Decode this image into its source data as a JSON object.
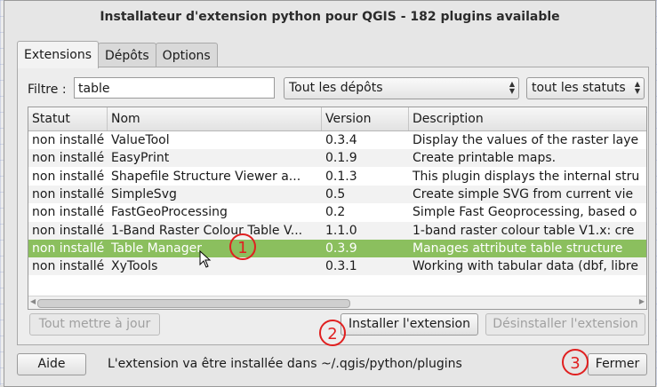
{
  "window": {
    "title": "Installateur d'extension python pour QGIS - 182 plugins available"
  },
  "tabs": [
    {
      "label": "Extensions",
      "active": true
    },
    {
      "label": "Dépôts",
      "active": false
    },
    {
      "label": "Options",
      "active": false
    }
  ],
  "filter": {
    "label": "Filtre :",
    "value": "table",
    "repository_select": "Tout les dépôts",
    "status_select": "tout les statuts"
  },
  "table": {
    "columns": [
      "Statut",
      "Nom",
      "Version",
      "Description"
    ],
    "rows": [
      {
        "status": "non installé",
        "name": "ValueTool",
        "version": "0.3.4",
        "description": "Display the values of the raster laye"
      },
      {
        "status": "non installé",
        "name": "EasyPrint",
        "version": "0.1.9",
        "description": "Create printable maps."
      },
      {
        "status": "non installé",
        "name": "Shapefile Structure Viewer a...",
        "version": "0.1.3",
        "description": "This plugin displays the internal stru"
      },
      {
        "status": "non installé",
        "name": "SimpleSvg",
        "version": "0.5",
        "description": "Create simple SVG from current vie"
      },
      {
        "status": "non installé",
        "name": "FastGeoProcessing",
        "version": "0.2",
        "description": "Simple Fast Geoprocessing, based o"
      },
      {
        "status": "non installé",
        "name": "1-Band Raster Colour Table V...",
        "version": "1.1.0",
        "description": "1-band raster colour table V1.x: cre"
      },
      {
        "status": "non installé",
        "name": "Table Manager",
        "version": "0.3.9",
        "description": "Manages attribute table structure",
        "selected": true
      },
      {
        "status": "non installé",
        "name": "XyTools",
        "version": "0.3.1",
        "description": "Working with tabular data (dbf, libre"
      }
    ]
  },
  "buttons": {
    "update_all": "Tout mettre à jour",
    "install": "Installer l'extension",
    "uninstall": "Désinstaller l'extension",
    "help": "Aide",
    "close": "Fermer"
  },
  "status_message": "L'extension va être installée dans ~/.qgis/python/plugins",
  "annotations": [
    "1",
    "2",
    "3"
  ],
  "colors": {
    "selected_row": "#8bbf5e",
    "annotation": "#e02020"
  }
}
